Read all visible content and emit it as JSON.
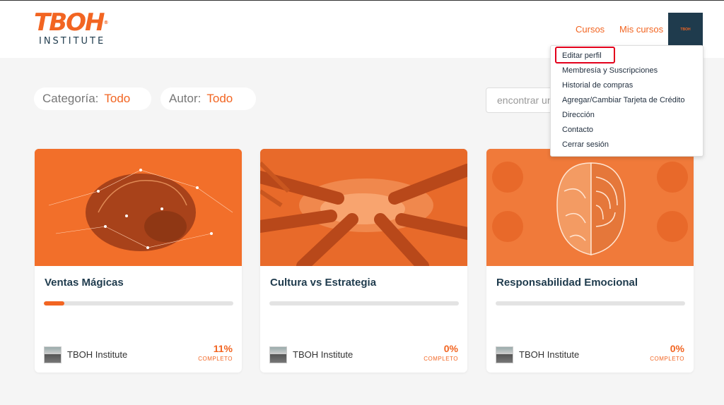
{
  "brand": {
    "logo_text": "TBOH",
    "logo_sub": "INSTITUTE",
    "accent": "#f26522",
    "navy": "#1f3b4d"
  },
  "nav": {
    "courses": "Cursos",
    "my_courses": "Mis cursos",
    "avatar_text": "TBOH"
  },
  "filters": {
    "category_label": "Categoría:",
    "category_value": "Todo",
    "author_label": "Autor:",
    "author_value": "Todo"
  },
  "search": {
    "placeholder": "encontrar un curso"
  },
  "dropdown": {
    "items": [
      "Editar perfil",
      "Membresía y Suscripciones",
      "Historial de compras",
      "Agregar/Cambiar Tarjeta de Crédito",
      "Dirección",
      "Contacto",
      "Cerrar sesión"
    ],
    "highlighted": "Editar perfil"
  },
  "courses": [
    {
      "title": "Ventas Mágicas",
      "progress": 0.11,
      "percent": "11%",
      "status": "COMPLETO",
      "author": "TBOH Institute"
    },
    {
      "title": "Cultura vs Estrategia",
      "progress": 0,
      "percent": "0%",
      "status": "COMPLETO",
      "author": "TBOH Institute"
    },
    {
      "title": "Responsabilidad Emocional",
      "progress": 0,
      "percent": "0%",
      "status": "COMPLETO",
      "author": "TBOH Institute"
    }
  ]
}
